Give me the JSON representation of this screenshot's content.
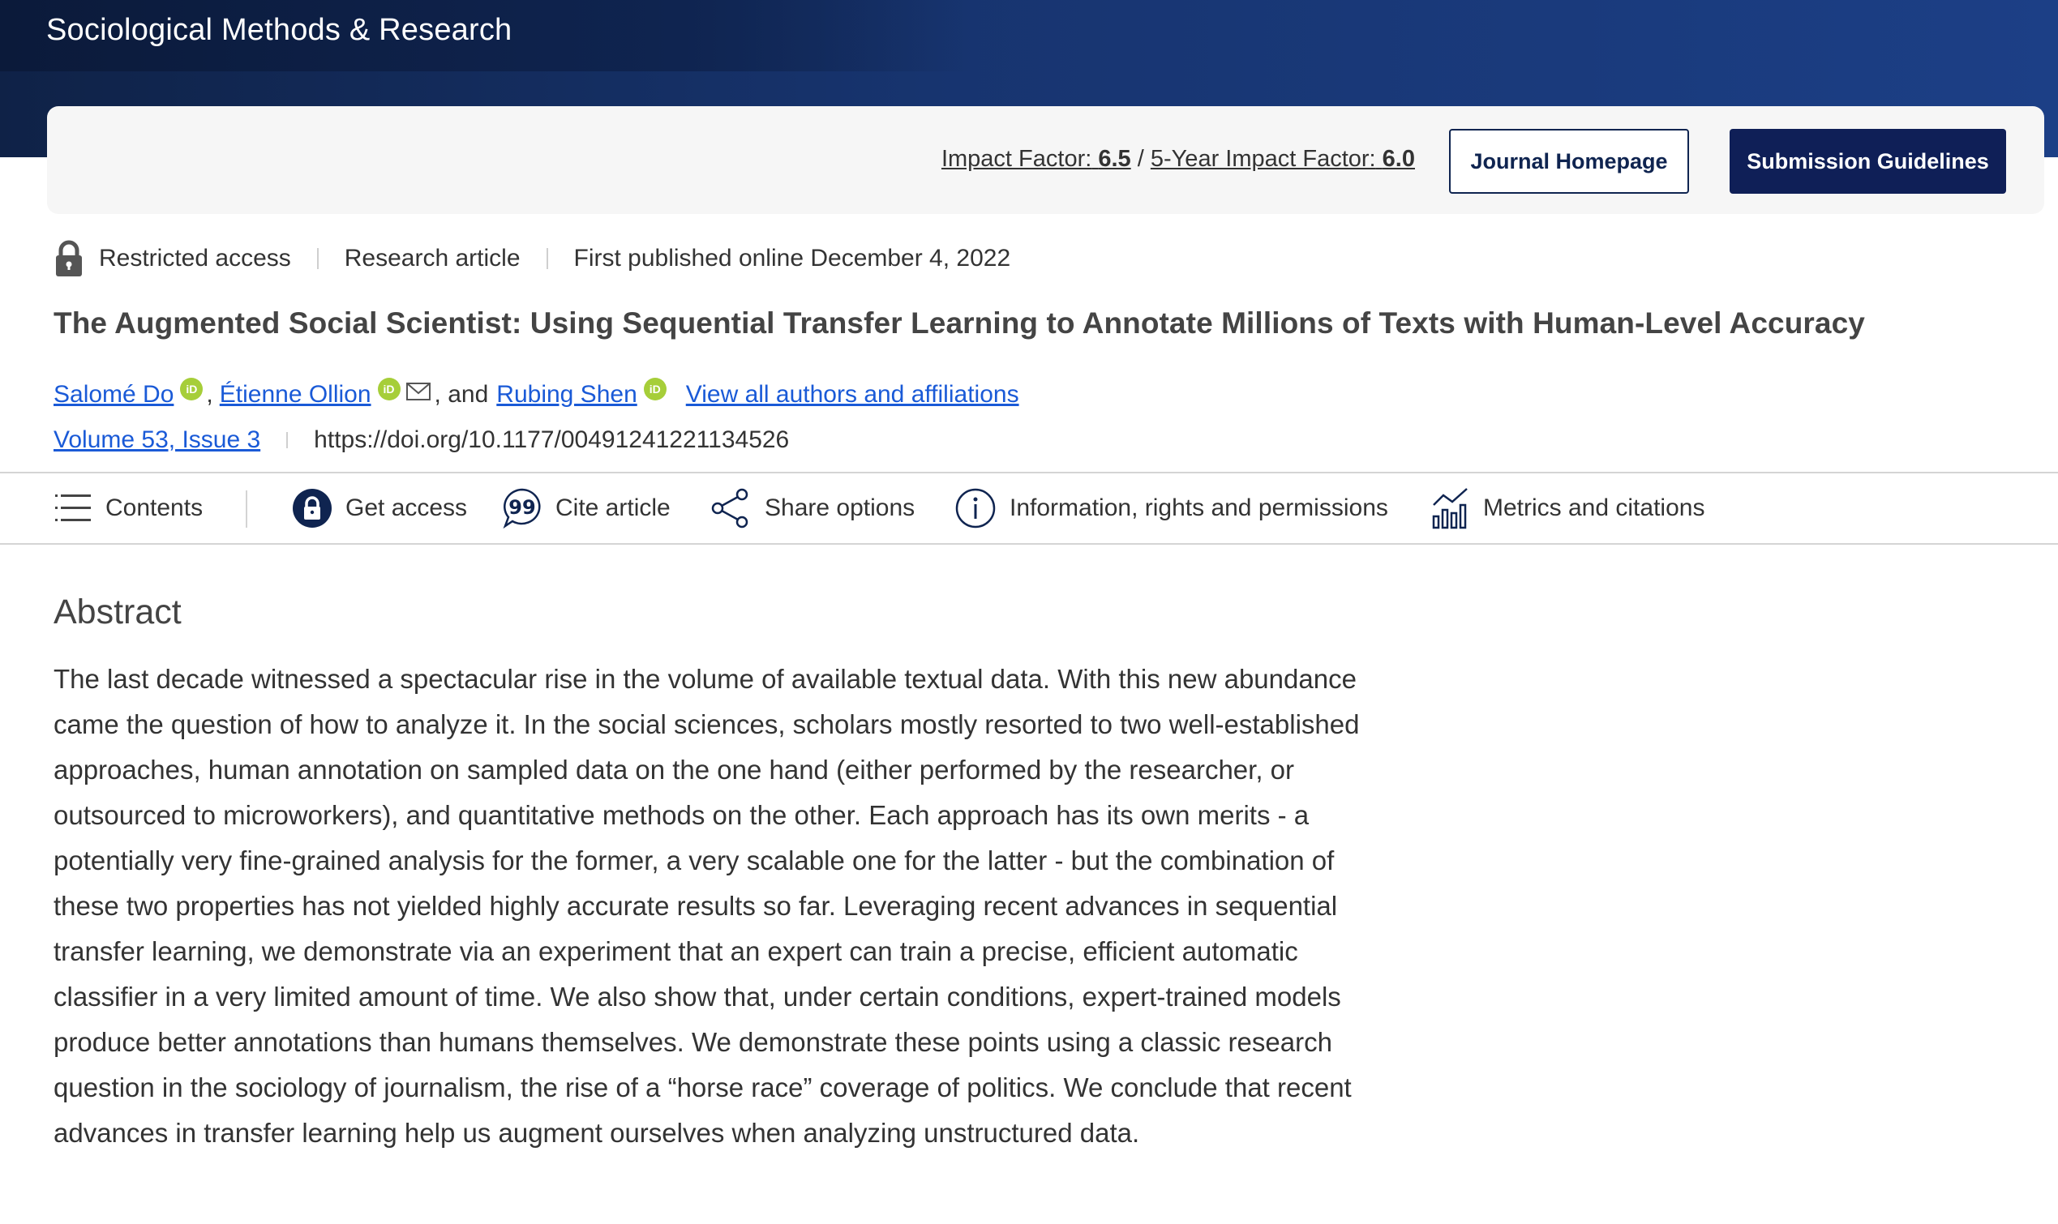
{
  "header": {
    "journal_title": "Sociological Methods & Research"
  },
  "banner": {
    "impact_label": "Impact Factor:",
    "impact_value": "6.5",
    "slash": " / ",
    "five_year_label": "5-Year Impact Factor:",
    "five_year_value": "6.0",
    "journal_homepage": "Journal Homepage",
    "submission_guidelines": "Submission Guidelines"
  },
  "meta": {
    "access": "Restricted access",
    "type": "Research article",
    "published": "First published online December 4, 2022"
  },
  "article": {
    "title": "The Augmented Social Scientist: Using Sequential Transfer Learning to Annotate Millions of Texts with Human-Level Accuracy"
  },
  "authors": {
    "author1": "Salomé Do",
    "comma1": ",",
    "author2": "Étienne Ollion",
    "and_text": ", and",
    "author3": "Rubing Shen",
    "view_all": "View all authors and affiliations",
    "orcid_label": "iD"
  },
  "volume": {
    "label": "Volume 53, Issue 3",
    "doi": "https://doi.org/10.1177/00491241221134526"
  },
  "nav": {
    "contents": "Contents",
    "get_access": "Get access",
    "cite": "Cite article",
    "share": "Share options",
    "info": "Information, rights and permissions",
    "metrics": "Metrics and citations"
  },
  "abstract": {
    "heading": "Abstract",
    "body": "The last decade witnessed a spectacular rise in the volume of available textual data. With this new abundance came the question of how to analyze it. In the social sciences, scholars mostly resorted to two well-established approaches, human annotation on sampled data on the one hand (either performed by the researcher, or outsourced to microworkers), and quantitative methods on the other. Each approach has its own merits - a potentially very fine-grained analysis for the former, a very scalable one for the latter - but the combination of these two properties has not yielded highly accurate results so far. Leveraging recent advances in sequential transfer learning, we demonstrate via an experiment that an expert can train a precise, efficient automatic classifier in a very limited amount of time. We also show that, under certain conditions, expert-trained models produce better annotations than humans themselves. We demonstrate these points using a classic research question in the sociology of journalism, the rise of a “horse race” coverage of politics. We conclude that recent advances in transfer learning help us augment ourselves when analyzing unstructured data."
  },
  "colors": {
    "header_dark": "#0f2247",
    "header_blue": "#1c3f86",
    "button_navy": "#0f1f57",
    "link_blue": "#1a5ad7",
    "orcid_green": "#a6ce39"
  },
  "icons": [
    "lock-icon",
    "orcid-icon",
    "mail-icon",
    "menu-icon",
    "lock-circle-icon",
    "quote-bubble-icon",
    "share-icon",
    "info-icon",
    "bar-chart-icon"
  ]
}
